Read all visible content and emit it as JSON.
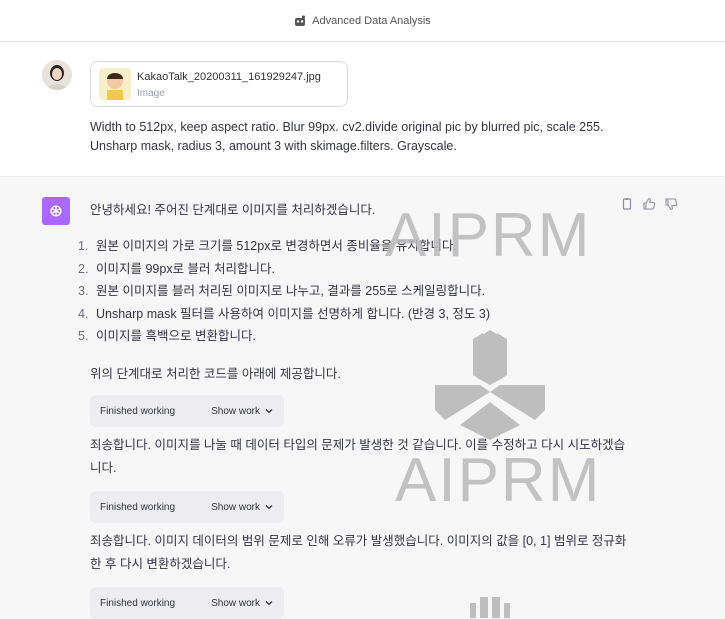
{
  "header": {
    "title": "Advanced Data Analysis",
    "icon": "plugin-icon"
  },
  "user_message": {
    "attachment": {
      "name": "KakaoTalk_20200311_161929247.jpg",
      "type": "Image"
    },
    "text": "Width to 512px, keep aspect ratio. Blur 99px. cv2.divide original pic by blurred pic, scale 255. Unsharp mask, radius 3, amount 3 with skimage.filters. Grayscale."
  },
  "assistant_message": {
    "intro": "안녕하세요! 주어진 단계대로 이미지를 처리하겠습니다.",
    "steps": [
      {
        "num": "1.",
        "text": "원본 이미지의 가로 크기를 512px로 변경하면서 종비율을 유지합니다."
      },
      {
        "num": "2.",
        "text": "이미지를 99px로 블러 처리합니다."
      },
      {
        "num": "3.",
        "text": "원본 이미지를 블러 처리된 이미지로 나누고, 결과를 255로 스케일링합니다."
      },
      {
        "num": "4.",
        "text": "Unsharp mask 필터를 사용하여 이미지를 선명하게 합니다. (반경 3, 정도 3)"
      },
      {
        "num": "5.",
        "text": "이미지를 흑백으로 변환합니다."
      }
    ],
    "para1": "위의 단계대로 처리한 코드를 아래에 제공합니다.",
    "para2": "죄송합니다. 이미지를 나눌 때 데이터 타입의 문제가 발생한 것 같습니다. 이를 수정하고 다시 시도하겠습니다.",
    "para3": "죄송합니다. 이미지 데이터의 범위 문제로 인해 오류가 발생했습니다. 이미지의 값을 [0, 1] 범위로 정규화한 후 다시 변환하겠습니다.",
    "work_blocks": [
      {
        "status": "Finished working",
        "toggle": "Show work"
      },
      {
        "status": "Finished working",
        "toggle": "Show work"
      },
      {
        "status": "Finished working",
        "toggle": "Show work"
      }
    ]
  },
  "watermark": {
    "text1": "AIPRM",
    "text2": "AIPRM"
  },
  "colors": {
    "gpt_avatar": "#ab68ff",
    "assistant_bg": "#f7f7f8",
    "button_bg": "#ececf1"
  }
}
